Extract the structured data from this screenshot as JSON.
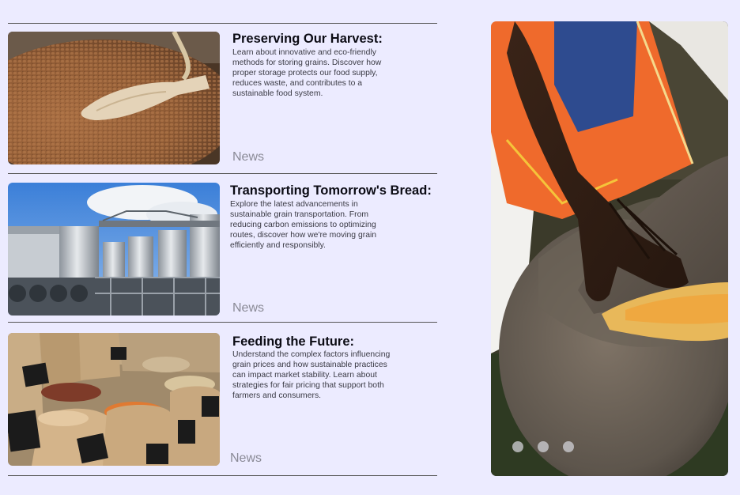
{
  "articles": [
    {
      "title": "Preserving Our Harvest:",
      "description": "Learn about innovative and eco-friendly methods for storing grains. Discover how proper storage protects our food supply, reduces waste, and contributes to a sustainable food system.",
      "tag": "News",
      "image": "buckwheat-with-wooden-scoop"
    },
    {
      "title": "Transporting Tomorrow's Bread:",
      "description": "Explore the latest advancements in sustainable grain transportation. From reducing carbon emissions to optimizing routes, discover how we're moving grain efficiently and responsibly.",
      "tag": "News",
      "image": "grain-silos-factory"
    },
    {
      "title": "Feeding the Future:",
      "description": "Understand the complex factors influencing grain prices and how sustainable practices can impact market stability. Learn about strategies for fair pricing that support both farmers and consumers.",
      "tag": "News",
      "image": "grain-sacks-market"
    }
  ],
  "hero": {
    "image": "hands-grinding-grain-on-stone",
    "slides": 3,
    "active_slide": 1
  },
  "colors": {
    "background": "#ecebff",
    "rule": "#555555",
    "title": "#0b0b14",
    "tag": "#8a8a96"
  }
}
